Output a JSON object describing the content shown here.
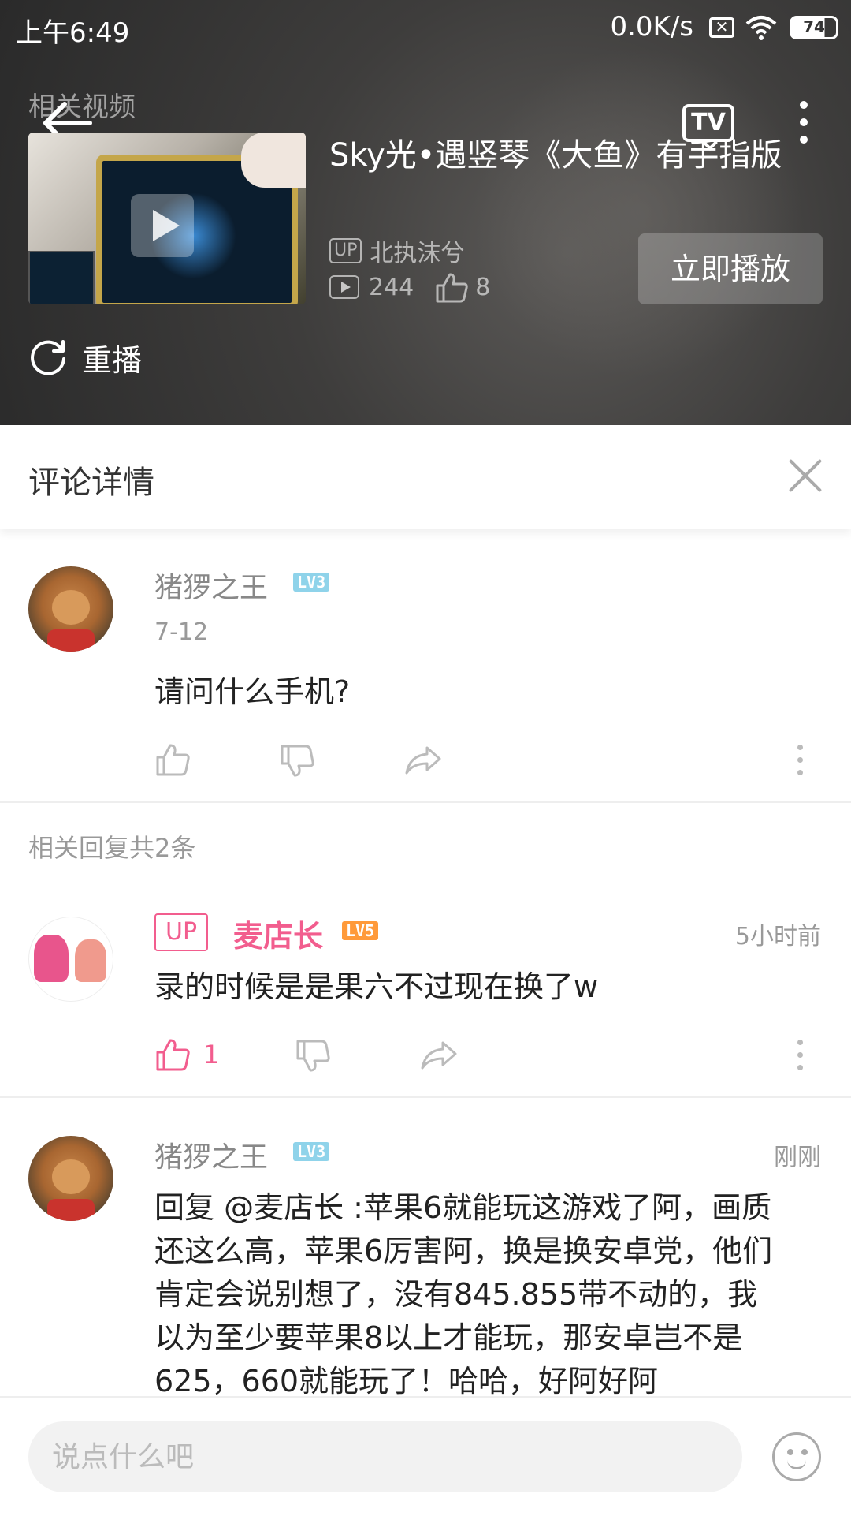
{
  "status_bar": {
    "time": "上午6:49",
    "network_speed": "0.0K/s",
    "battery": "74"
  },
  "video_overlay": {
    "section_label": "相关视频",
    "tv_label": "TV",
    "title": "Sky光•遇竖琴《大鱼》有手指版",
    "up_tag": "UP",
    "uploader": "北执沫兮",
    "plays": "244",
    "likes": "8",
    "play_now_label": "立即播放",
    "replay_label": "重播"
  },
  "panel": {
    "title": "评论详情"
  },
  "main_comment": {
    "username": "猪猡之王",
    "level": "LV3",
    "date": "7-12",
    "text": "请问什么手机?"
  },
  "replies_label": "相关回复共2条",
  "replies": [
    {
      "up_tag": "UP",
      "username": "麦店长",
      "level": "LV5",
      "time": "5小时前",
      "text": "录的时候是是果六不过现在换了w",
      "likes": "1"
    },
    {
      "username": "猪猡之王",
      "level": "LV3",
      "time": "刚刚",
      "text_lines": [
        "回复 @麦店长 :苹果6就能玩这游戏了阿，画质",
        "还这么高，苹果6厉害阿，换是换安卓党，他们",
        "肯定会说别想了，没有845.855带不动的，我",
        "以为至少要苹果8以上才能玩，那安卓岂不是",
        "625，660就能玩了！哈哈，好阿好阿"
      ]
    }
  ],
  "input": {
    "placeholder": "说点什么吧"
  },
  "colors": {
    "accent_pink": "#f25d8e",
    "level3": "#8fd3ea",
    "level5": "#ff9a3a"
  }
}
